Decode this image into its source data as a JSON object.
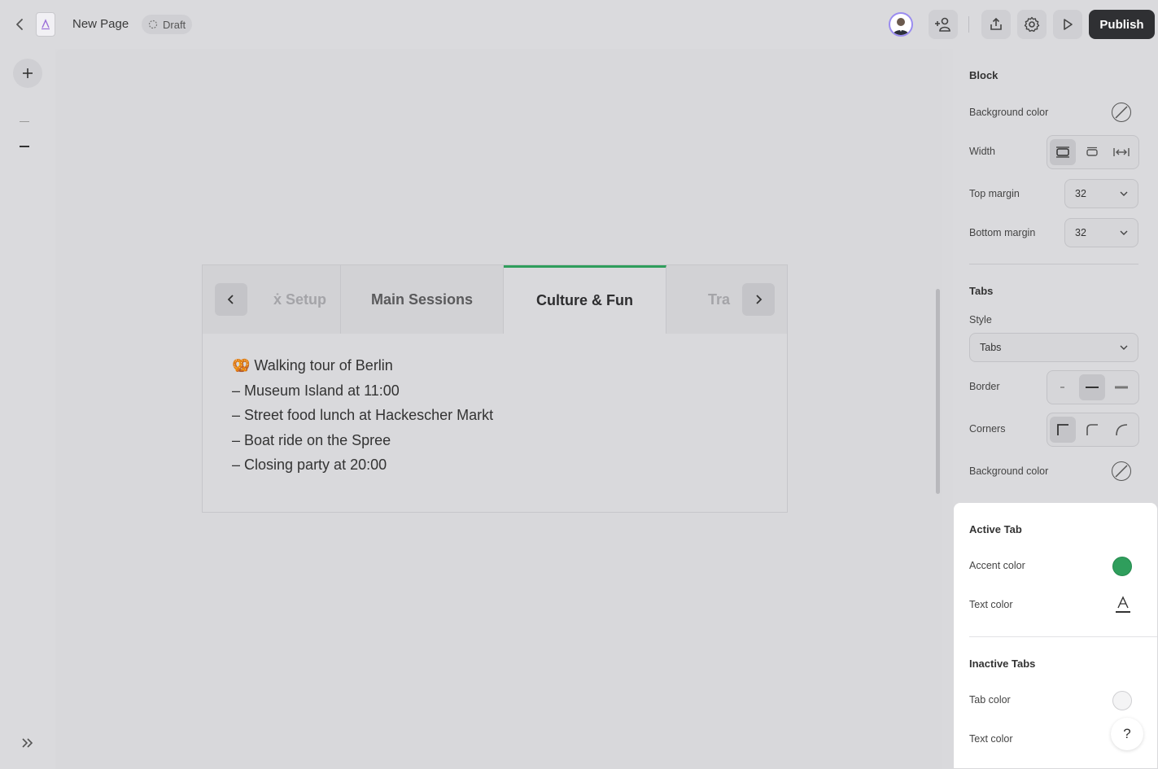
{
  "topbar": {
    "title": "New Page",
    "status": "Draft",
    "publish_label": "Publish"
  },
  "tabs": {
    "items": [
      {
        "label": "ẋ Setup"
      },
      {
        "label": "Main Sessions"
      },
      {
        "label": "Culture & Fun"
      },
      {
        "label": "Tra"
      }
    ],
    "active_index": 2,
    "content_lines": [
      "🥨 Walking tour of Berlin",
      "– Museum Island at 11:00",
      "– Street food lunch at Hackescher Markt",
      "– Boat ride on the Spree",
      "– Closing party at 20:00"
    ]
  },
  "panel": {
    "block_heading": "Block",
    "block_bg_label": "Background color",
    "width_label": "Width",
    "top_margin_label": "Top margin",
    "top_margin_value": "32",
    "bottom_margin_label": "Bottom margin",
    "bottom_margin_value": "32",
    "tabs_heading": "Tabs",
    "style_label": "Style",
    "style_value": "Tabs",
    "border_label": "Border",
    "corners_label": "Corners",
    "tabs_bg_label": "Background color",
    "active_heading": "Active Tab",
    "accent_label": "Accent color",
    "accent_color": "#2f9e5c",
    "active_text_label": "Text color",
    "inactive_heading": "Inactive Tabs",
    "tab_color_label": "Tab color",
    "inactive_text_label": "Text color"
  },
  "help_label": "?"
}
